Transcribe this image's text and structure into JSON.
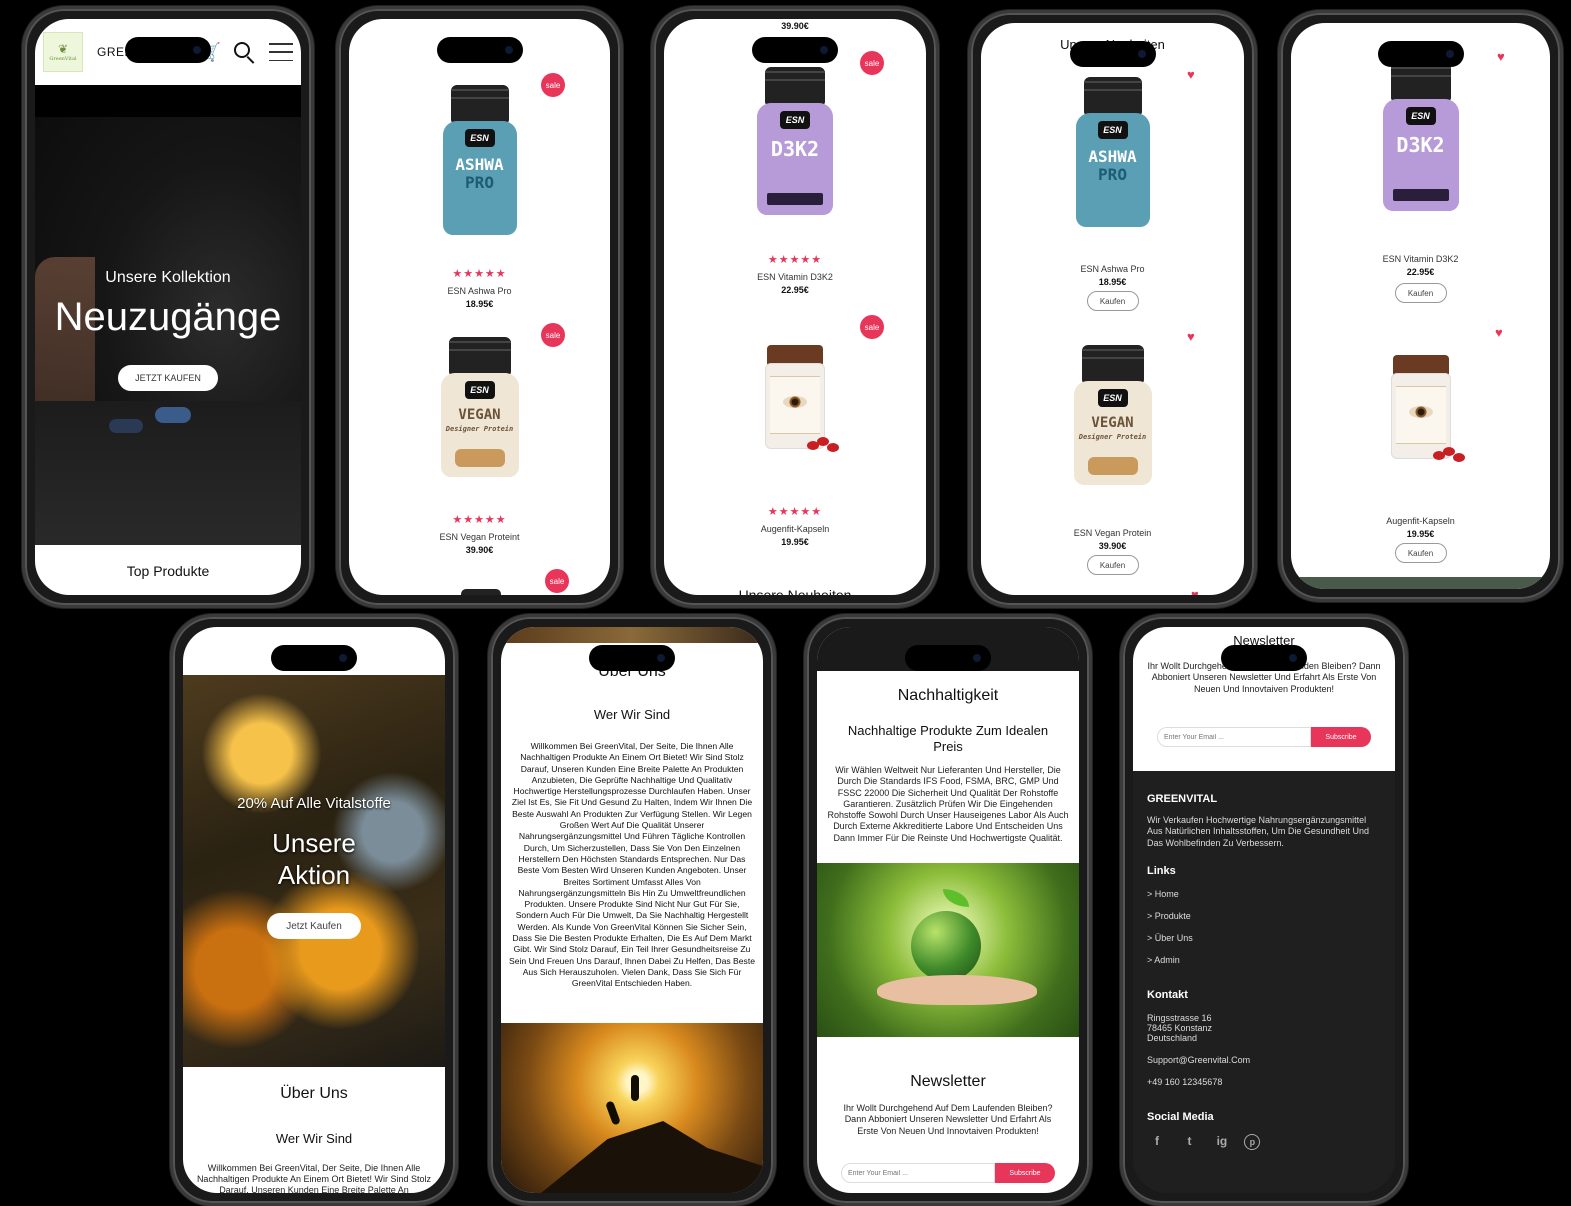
{
  "p1": {
    "logo_text": "GreenVital",
    "brand": "GREENVITAL",
    "hero_sub": "Unsere Kollektion",
    "hero_title": "Neuzugänge",
    "hero_btn": "JETZT KAUFEN",
    "section": "Top Produkte"
  },
  "p2": {
    "sale": "sale",
    "items": [
      {
        "name": "ESN Ashwa Pro",
        "price": "18.95€",
        "stars": "★★★★★"
      },
      {
        "name": "ESN Vegan Proteint",
        "price": "39.90€",
        "stars": "★★★★★"
      }
    ]
  },
  "p3": {
    "top_price": "39.90€",
    "sale": "sale",
    "items": [
      {
        "name": "ESN Vitamin D3K2",
        "price": "22.95€",
        "stars": "★★★★★"
      },
      {
        "name": "Augenfit-Kapseln",
        "price": "19.95€",
        "stars": "★★★★★"
      }
    ],
    "section": "Unsere Neuheiten"
  },
  "p4": {
    "section": "Unsere Neuheiten",
    "buy": "Kaufen",
    "items": [
      {
        "name": "ESN Ashwa Pro",
        "price": "18.95€"
      },
      {
        "name": "ESN Vegan Protein",
        "price": "39.90€"
      }
    ]
  },
  "p5": {
    "buy": "Kaufen",
    "items": [
      {
        "name": "ESN Vitamin D3K2",
        "price": "22.95€"
      },
      {
        "name": "Augenfit-Kapseln",
        "price": "19.95€"
      }
    ]
  },
  "products": {
    "ashwa": {
      "line1": "ASHWA",
      "line2": "PRO",
      "logo": "ESN"
    },
    "vegan": {
      "line1": "VEGAN",
      "line2": "Designer Protein",
      "logo": "ESN"
    },
    "d3k2": {
      "line1": "D3K2",
      "logo": "ESN"
    }
  },
  "p6": {
    "promo": "20% Auf Alle Vitalstoffe",
    "title": "Unsere Aktion",
    "btn": "Jetzt Kaufen",
    "about": "Über Uns",
    "who": "Wer Wir Sind",
    "text": "Willkommen Bei GreenVital, Der Seite, Die Ihnen Alle Nachhaltigen Produkte An Einem Ort Bietet! Wir Sind Stolz Darauf, Unseren Kunden Eine Breite Palette An"
  },
  "p7": {
    "about": "Über Uns",
    "who": "Wer Wir Sind",
    "text": "Willkommen Bei GreenVital, Der Seite, Die Ihnen Alle Nachhaltigen Produkte An Einem Ort Bietet! Wir Sind Stolz Darauf, Unseren Kunden Eine Breite Palette An Produkten Anzubieten, Die Geprüfte Nachhaltige Und Qualitativ Hochwertige Herstellungsprozesse Durchlaufen Haben. Unser Ziel Ist Es, Sie Fit Und Gesund Zu Halten, Indem Wir Ihnen Die Beste Auswahl An Produkten Zur Verfügung Stellen. Wir Legen Großen Wert Auf Die Qualität Unserer Nahrungsergänzungsmittel Und Führen Tägliche Kontrollen Durch, Um Sicherzustellen, Dass Sie Von Den Einzelnen Herstellern Den Höchsten Standards Entsprechen. Nur Das Beste Vom Besten Wird Unseren Kunden Angeboten. Unser Breites Sortiment Umfasst Alles Von Nahrungsergänzungsmitteln Bis Hin Zu Umweltfreundlichen Produkten. Unsere Produkte Sind Nicht Nur Gut Für Sie, Sondern Auch Für Die Umwelt, Da Sie Nachhaltig Hergestellt Werden. Als Kunde Von GreenVital Können Sie Sicher Sein, Dass Sie Die Besten Produkte Erhalten, Die Es Auf Dem Markt Gibt. Wir Sind Stolz Darauf, Ein Teil Ihrer Gesundheitsreise Zu Sein Und Freuen Uns Darauf, Ihnen Dabei Zu Helfen, Das Beste Aus Sich Herauszuholen. Vielen Dank, Dass Sie Sich Für GreenVital Entschieden Haben."
  },
  "p8": {
    "title": "Nachhaltigkeit",
    "sub": "Nachhaltige Produkte Zum Idealen Preis",
    "text": "Wir Wählen Weltweit Nur Lieferanten Und Hersteller, Die Durch Die Standards IFS Food, FSMA, BRC, GMP Und FSSC 22000 Die Sicherheit Und Qualität Der Rohstoffe Garantieren. Zusätzlich Prüfen Wir Die Eingehenden Rohstoffe Sowohl Durch Unser Hauseigenes Labor Als Auch Durch Externe Akkreditierte Labore Und Entscheiden Uns Dann Immer Für Die Reinste Und Hochwertigste Qualität.",
    "newsletter": "Newsletter",
    "nl_text": "Ihr Wollt Durchgehend Auf Dem Laufenden Bleiben? Dann Abboniert Unseren Newsletter Und Erfahrt Als Erste Von Neuen Und Innovtaiven Produkten!",
    "email_ph": "Enter Your Email ...",
    "subscribe": "Subscribe"
  },
  "p9": {
    "newsletter": "Newsletter",
    "nl_text": "Ihr Wollt Durchgehend Auf Dem Laufenden Bleiben? Dann Abboniert Unseren Newsletter Und Erfahrt Als Erste Von Neuen Und Innovtaiven Produkten!",
    "email_ph": "Enter Your Email ...",
    "subscribe": "Subscribe",
    "brand": "GREENVITAL",
    "brand_text": "Wir Verkaufen Hochwertige Nahrungsergänzungsmittel Aus Natürlichen Inhaltsstoffen, Um Die Gesundheit Und Das Wohlbefinden Zu Verbessern.",
    "links_title": "Links",
    "links": [
      "> Home",
      "> Produkte",
      "> Über Uns",
      "> Admin"
    ],
    "contact_title": "Kontakt",
    "address": [
      "Ringsstrasse 16",
      "78465 Konstanz",
      "Deutschland"
    ],
    "email": "Support@Greenvital.Com",
    "phone": "+49 160 12345678",
    "social_title": "Social Media",
    "social": [
      "f",
      "t",
      "ig",
      "p"
    ]
  },
  "colors": {
    "accent": "#e8355a",
    "footer": "#1f1f1f"
  }
}
